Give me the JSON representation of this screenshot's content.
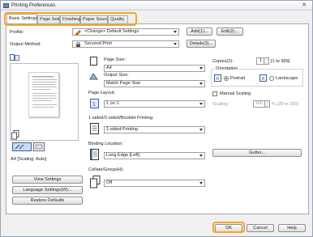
{
  "window": {
    "title": "Printing Preferences",
    "close_glyph": "✕"
  },
  "tabs": [
    {
      "label": "Basic Settings",
      "active": true
    },
    {
      "label": "Page Setup",
      "active": false
    },
    {
      "label": "Finishing",
      "active": false
    },
    {
      "label": "Paper Source",
      "active": false
    },
    {
      "label": "Quality",
      "active": false
    }
  ],
  "profile": {
    "label": "Profile:",
    "value": "<Change> Default Settings",
    "add_label": "Add(1)...",
    "edit_label": "Edit(2)..."
  },
  "output_method": {
    "label": "Output Method:",
    "value": "Secured Print",
    "details_label": "Details(3)..."
  },
  "page_size": {
    "label": "Page Size:",
    "value": "A4"
  },
  "output_size": {
    "label": "Output Size:",
    "value": "Match Page Size"
  },
  "page_layout": {
    "label": "Page Layout:",
    "value": "1 on 1"
  },
  "sided": {
    "label": "1-sided/2-sided/Booklet Printing:",
    "value": "1-sided Printing"
  },
  "binding": {
    "label": "Binding Location:",
    "value": "Long Edge [Left]",
    "gutter_label": "Gutter..."
  },
  "collate": {
    "label": "Collate/Group(H):",
    "value": "Off"
  },
  "copies": {
    "label": "Copies(2):",
    "value": "1",
    "range": "[1 to 999]"
  },
  "orientation": {
    "label": "Orientation",
    "portrait": "Portrait",
    "landscape": "Landscape",
    "selected": "portrait"
  },
  "manual_scaling": {
    "label": "Manual Scaling",
    "checked": false
  },
  "scaling": {
    "label": "Scaling:",
    "value": "100",
    "range": "% [25 to 200]"
  },
  "preview": {
    "caption": "A4 [Scaling: Auto]"
  },
  "left_buttons": {
    "view_settings": "View Settings",
    "language_settings": "Language Settings(W)...",
    "restore_defaults": "Restore Defaults"
  },
  "footer": {
    "ok": "OK",
    "cancel": "Cancel",
    "help": "Help"
  },
  "colors": {
    "highlight": "#f5a623",
    "accent": "#1a4e9c"
  }
}
